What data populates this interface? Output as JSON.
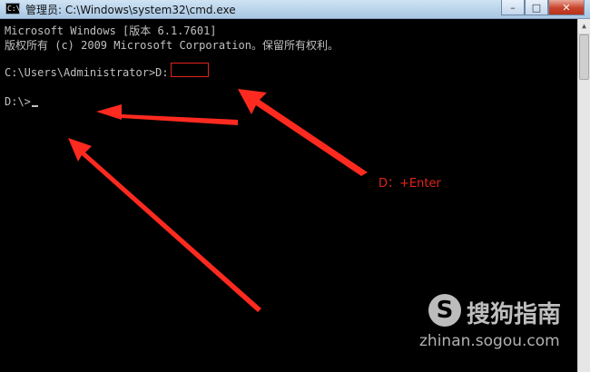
{
  "window": {
    "icon_text": "C:\\",
    "title": "管理员: C:\\Windows\\system32\\cmd.exe",
    "buttons": {
      "minimize": "–",
      "maximize": "□",
      "close": "✕"
    }
  },
  "console": {
    "lines": [
      "Microsoft Windows [版本 6.1.7601]",
      "版权所有 (c) 2009 Microsoft Corporation。保留所有权利。",
      "",
      "C:\\Users\\Administrator>D:",
      "",
      "D:\\>"
    ]
  },
  "annotation": {
    "text": "D：+Enter",
    "color": "#e2231a"
  },
  "watermark": {
    "logo_glyph": "S",
    "brand": "搜狗指南",
    "url": "zhinan.sogou.com"
  },
  "icons": [
    "cmd-app-icon",
    "minimize-icon",
    "maximize-icon",
    "close-icon",
    "scroll-up-icon"
  ]
}
